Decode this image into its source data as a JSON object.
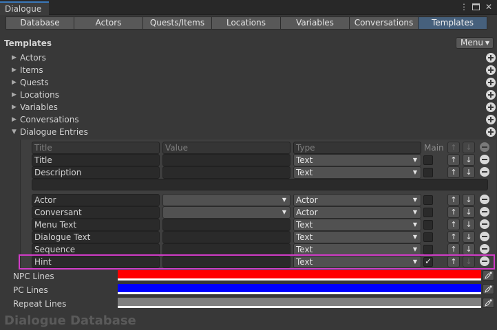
{
  "window": {
    "title": "Dialogue"
  },
  "tabs": [
    "Database",
    "Actors",
    "Quests/Items",
    "Locations",
    "Variables",
    "Conversations",
    "Templates"
  ],
  "active_tab": "Templates",
  "section_title": "Templates",
  "menu_label": "Menu",
  "foldouts": [
    "Actors",
    "Items",
    "Quests",
    "Locations",
    "Variables",
    "Conversations",
    "Dialogue Entries"
  ],
  "header": {
    "title": "Title",
    "value": "Value",
    "type": "Type",
    "main": "Main"
  },
  "rows": [
    {
      "title": "Title",
      "value": "",
      "type": "Text",
      "main": false
    },
    {
      "title": "Description",
      "value": "",
      "type": "Text",
      "main": false
    },
    {
      "title": "Actor",
      "value": "",
      "type": "Actor",
      "main": false
    },
    {
      "title": "Conversant",
      "value": "",
      "type": "Actor",
      "main": false
    },
    {
      "title": "Menu Text",
      "value": "",
      "type": "Text",
      "main": false
    },
    {
      "title": "Dialogue Text",
      "value": "",
      "type": "Text",
      "main": false
    },
    {
      "title": "Sequence",
      "value": "",
      "type": "Text",
      "main": false
    },
    {
      "title": "Hint",
      "value": "",
      "type": "Text",
      "main": true
    }
  ],
  "colors": [
    {
      "label": "NPC Lines",
      "color": "#ff0000"
    },
    {
      "label": "PC Lines",
      "color": "#0000ff"
    },
    {
      "label": "Repeat Lines",
      "color": "#808080"
    }
  ],
  "footer": "Dialogue Database",
  "accent": {
    "active_tab": "#46607c",
    "highlight": "#d23cc8",
    "window_tab": "#3a79bb"
  },
  "icons": {
    "up": "↑",
    "down": "↓",
    "dropdown": "▼",
    "fold_closed": "▶",
    "fold_open": "▼"
  }
}
